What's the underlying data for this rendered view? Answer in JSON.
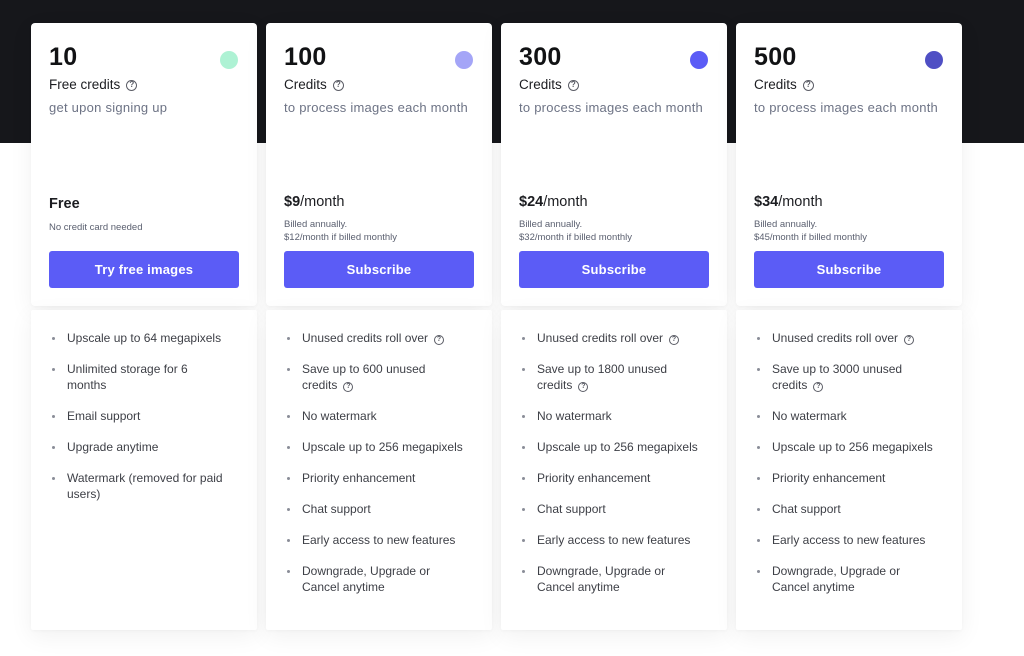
{
  "plans": [
    {
      "credits": "10",
      "credits_label": "Free credits",
      "description": "get upon signing up",
      "dot_color": "#aef2d4",
      "price_main": "Free",
      "price_suffix": "",
      "price_note_1": "No credit card needed",
      "price_note_2": "",
      "cta": "Try free images",
      "features": [
        {
          "text": "Upscale up to 64 megapixels",
          "help": false
        },
        {
          "text": "Unlimited storage for 6 months",
          "help": false
        },
        {
          "text": "Email support",
          "help": false
        },
        {
          "text": "Upgrade anytime",
          "help": false
        },
        {
          "text": "Watermark (removed for paid users)",
          "help": false
        }
      ]
    },
    {
      "credits": "100",
      "credits_label": "Credits",
      "description": "to process images each month",
      "dot_color": "#a4a5f7",
      "price_main": "$9",
      "price_suffix": "/month",
      "price_note_1": "Billed annually.",
      "price_note_2": "$12/month if billed monthly",
      "cta": "Subscribe",
      "features": [
        {
          "text": "Unused credits roll over",
          "help": true
        },
        {
          "text": "Save up to 600 unused credits",
          "help": true
        },
        {
          "text": "No watermark",
          "help": false
        },
        {
          "text": "Upscale up to 256 megapixels",
          "help": false
        },
        {
          "text": "Priority enhancement",
          "help": false
        },
        {
          "text": "Chat support",
          "help": false
        },
        {
          "text": "Early access to new features",
          "help": false
        },
        {
          "text": "Downgrade, Upgrade or Cancel anytime",
          "help": false
        }
      ]
    },
    {
      "credits": "300",
      "credits_label": "Credits",
      "description": "to process images each month",
      "dot_color": "#5b5cf6",
      "price_main": "$24",
      "price_suffix": "/month",
      "price_note_1": "Billed annually.",
      "price_note_2": "$32/month if billed monthly",
      "cta": "Subscribe",
      "features": [
        {
          "text": "Unused credits roll over",
          "help": true
        },
        {
          "text": "Save up to 1800 unused credits",
          "help": true
        },
        {
          "text": "No watermark",
          "help": false
        },
        {
          "text": "Upscale up to 256 megapixels",
          "help": false
        },
        {
          "text": "Priority enhancement",
          "help": false
        },
        {
          "text": "Chat support",
          "help": false
        },
        {
          "text": "Early access to new features",
          "help": false
        },
        {
          "text": "Downgrade, Upgrade or Cancel anytime",
          "help": false
        }
      ]
    },
    {
      "credits": "500",
      "credits_label": "Credits",
      "description": "to process images each month",
      "dot_color": "#4f4fc4",
      "price_main": "$34",
      "price_suffix": "/month",
      "price_note_1": "Billed annually.",
      "price_note_2": "$45/month if billed monthly",
      "cta": "Subscribe",
      "features": [
        {
          "text": "Unused credits roll over",
          "help": true
        },
        {
          "text": "Save up to 3000 unused credits",
          "help": true
        },
        {
          "text": "No watermark",
          "help": false
        },
        {
          "text": "Upscale up to 256 megapixels",
          "help": false
        },
        {
          "text": "Priority enhancement",
          "help": false
        },
        {
          "text": "Chat support",
          "help": false
        },
        {
          "text": "Early access to new features",
          "help": false
        },
        {
          "text": "Downgrade, Upgrade or Cancel anytime",
          "help": false
        }
      ]
    }
  ],
  "help_glyph": "?",
  "colors": {
    "accent": "#5b5cf6",
    "header_band": "#16171b"
  }
}
